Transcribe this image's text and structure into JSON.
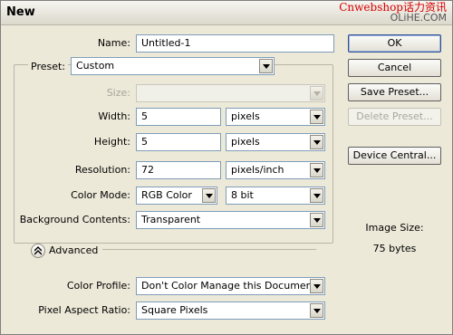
{
  "window": {
    "title": "New"
  },
  "watermark": {
    "line1": "Cnwebshop话力资讯",
    "line2": "OLiHE.COM"
  },
  "fields": {
    "name_label": "Name:",
    "name_value": "Untitled-1",
    "preset_label": "Preset:",
    "preset_value": "Custom",
    "size_label": "Size:",
    "size_value": "",
    "width_label": "Width:",
    "width_value": "5",
    "width_unit": "pixels",
    "height_label": "Height:",
    "height_value": "5",
    "height_unit": "pixels",
    "resolution_label": "Resolution:",
    "resolution_value": "72",
    "resolution_unit": "pixels/inch",
    "color_mode_label": "Color Mode:",
    "color_mode_value": "RGB Color",
    "bit_depth_value": "8 bit",
    "background_label": "Background Contents:",
    "background_value": "Transparent"
  },
  "advanced": {
    "toggle_label": "Advanced",
    "color_profile_label": "Color Profile:",
    "color_profile_value": "Don't Color Manage this Document",
    "pixel_aspect_label": "Pixel Aspect Ratio:",
    "pixel_aspect_value": "Square Pixels"
  },
  "buttons": {
    "ok": "OK",
    "cancel": "Cancel",
    "save_preset": "Save Preset...",
    "delete_preset": "Delete Preset...",
    "device_central": "Device Central..."
  },
  "image_size": {
    "label": "Image Size:",
    "value": "75 bytes"
  },
  "icons": {
    "dropdown": "chevron-down-icon",
    "advanced_toggle": "chevron-up-double-icon"
  }
}
